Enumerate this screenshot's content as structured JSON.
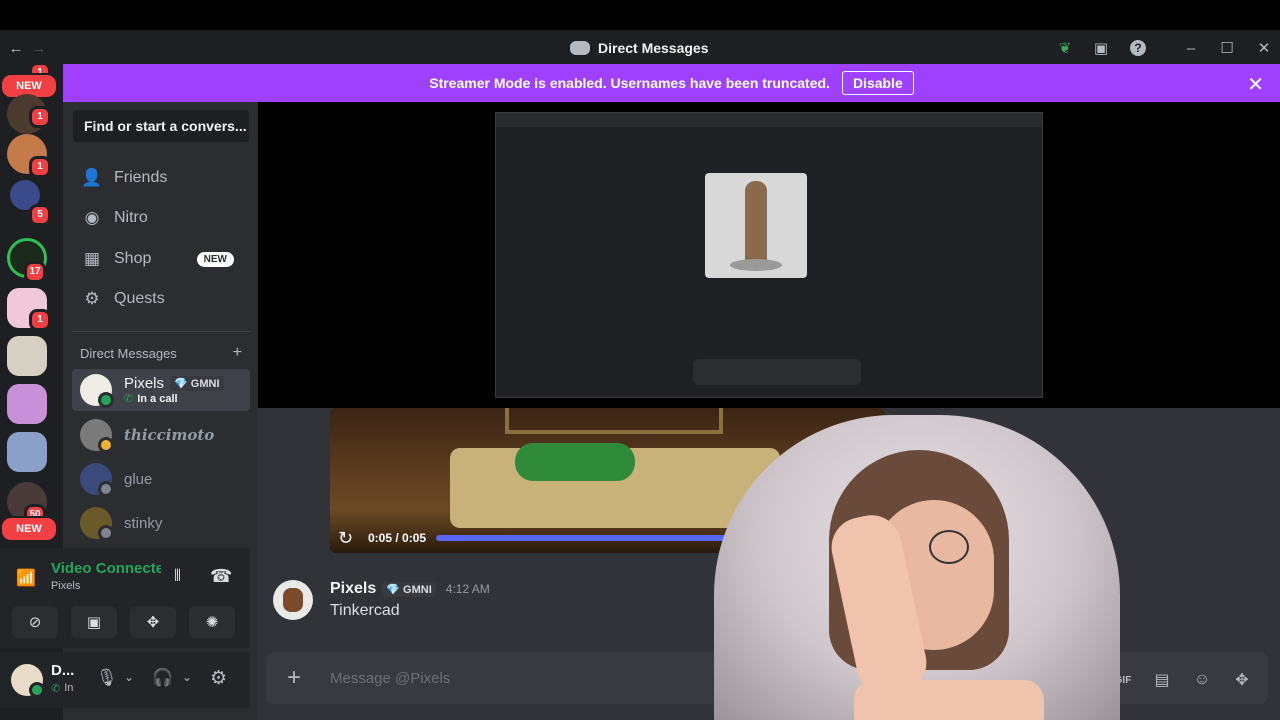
{
  "window": {
    "title": "Direct Messages",
    "back_icon": "arrow-left-icon",
    "forward_icon": "arrow-right-icon"
  },
  "banner": {
    "text": "Streamer Mode is enabled. Usernames have been truncated.",
    "button": "Disable",
    "color": "#a040ff"
  },
  "guild_rail": {
    "top_badge": "1",
    "new_label_top": "NEW",
    "new_label_bottom": "NEW",
    "badges": [
      "1",
      "1",
      "5",
      "17",
      "1",
      "50"
    ]
  },
  "sidebar": {
    "search_placeholder": "Find or start a convers...",
    "nav": [
      {
        "label": "Friends",
        "icon": "friends-icon"
      },
      {
        "label": "Nitro",
        "icon": "nitro-icon"
      },
      {
        "label": "Shop",
        "icon": "shop-icon",
        "tag": "NEW"
      },
      {
        "label": "Quests",
        "icon": "quests-icon"
      }
    ],
    "dm_header": "Direct Messages",
    "dms": [
      {
        "name": "Pixels",
        "tag": "GMNI",
        "status": "In a call"
      },
      {
        "name": "thiccimoto"
      },
      {
        "name": "glue"
      },
      {
        "name": "stinky"
      }
    ]
  },
  "voice_panel": {
    "status": "Video Connecte",
    "channel": "Pixels"
  },
  "user_panel": {
    "name": "D...",
    "status": "In"
  },
  "video": {
    "time": "0:05 / 0:05",
    "progress": 1.0
  },
  "message": {
    "author": "Pixels",
    "tag": "GMNI",
    "time": "4:12 AM",
    "text": "Tinkercad"
  },
  "composer": {
    "placeholder": "Message @Pixels",
    "gif_label": "GIF"
  }
}
